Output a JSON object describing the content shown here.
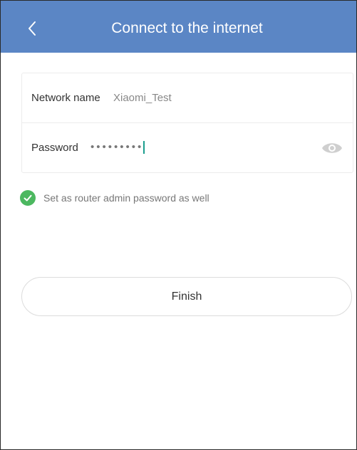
{
  "header": {
    "title": "Connect to the internet",
    "background_color": "#5b86c5",
    "back_icon": "chevron-left-icon"
  },
  "form": {
    "network_name": {
      "label": "Network name",
      "value": "Xiaomi_Test"
    },
    "password": {
      "label": "Password",
      "masked_value": "•••••••••",
      "toggle_icon": "eye-icon"
    }
  },
  "admin_password_option": {
    "label": "Set as router admin password as well",
    "checked": true,
    "check_color": "#4cb860"
  },
  "finish_button": {
    "label": "Finish"
  }
}
